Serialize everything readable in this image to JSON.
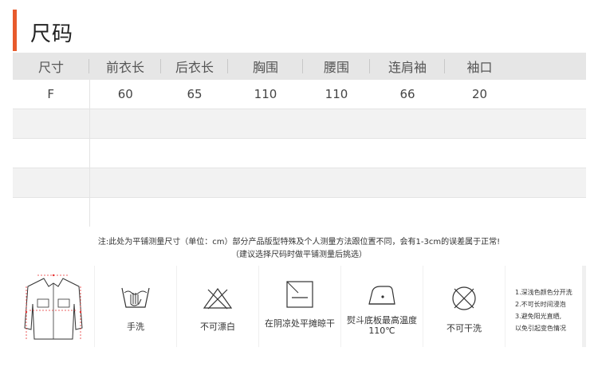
{
  "title": "尺码",
  "table": {
    "headers": [
      "尺寸",
      "前衣长",
      "后衣长",
      "胸围",
      "腰围",
      "连肩袖",
      "袖口"
    ],
    "rows": [
      [
        "F",
        "60",
        "65",
        "110",
        "110",
        "66",
        "20"
      ]
    ]
  },
  "note": {
    "line1": "注:此处为平铺测量尺寸（单位：cm）部分产品版型特殊及个人测量方法跟位置不同，会有1-3cm的误差属于正常!",
    "line2": "（建议选择尺码时做平铺测量后挑选）"
  },
  "care": {
    "items": [
      {
        "icon": "shirt-measure-icon",
        "label": ""
      },
      {
        "icon": "hand-wash-icon",
        "label": "手洗"
      },
      {
        "icon": "no-bleach-icon",
        "label": "不可漂白"
      },
      {
        "icon": "shade-dry-flat-icon",
        "label": "在阴凉处平摊晾干"
      },
      {
        "icon": "iron-icon",
        "label": "熨斗底板最高温度110℃"
      },
      {
        "icon": "no-dry-clean-icon",
        "label": "不可干洗"
      }
    ],
    "notes": [
      "1.深浅色颜色分开洗",
      "2.不可长时间浸泡",
      "3.避免阳光直晒,",
      "以免引起变色情况"
    ]
  },
  "colors": {
    "accent": "#e85a2c",
    "header_bg": "#e6e6e6",
    "stripe_bg": "#f2f2f2"
  }
}
